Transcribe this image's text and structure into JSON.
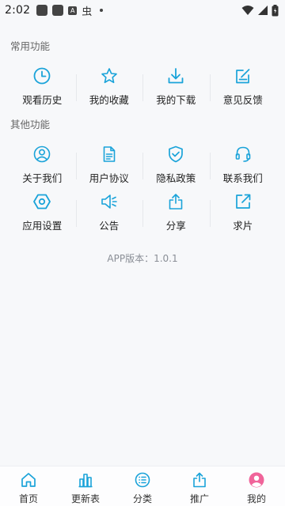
{
  "status_bar": {
    "time": "2:02",
    "notif_letter": "A",
    "notif_glyph": "虫"
  },
  "accent_color": "#1aa3d9",
  "avatar_color": "#f0649a",
  "sections": [
    {
      "title": "常用功能",
      "rows": [
        [
          {
            "label": "观看历史",
            "icon": "clock-icon"
          },
          {
            "label": "我的收藏",
            "icon": "star-icon"
          },
          {
            "label": "我的下载",
            "icon": "download-icon"
          },
          {
            "label": "意见反馈",
            "icon": "edit-icon"
          }
        ]
      ]
    },
    {
      "title": "其他功能",
      "rows": [
        [
          {
            "label": "关于我们",
            "icon": "user-icon"
          },
          {
            "label": "用户协议",
            "icon": "document-icon"
          },
          {
            "label": "隐私政策",
            "icon": "shield-check-icon"
          },
          {
            "label": "联系我们",
            "icon": "headset-icon"
          }
        ],
        [
          {
            "label": "应用设置",
            "icon": "hexagon-settings-icon"
          },
          {
            "label": "公告",
            "icon": "speaker-icon"
          },
          {
            "label": "分享",
            "icon": "share-icon"
          },
          {
            "label": "求片",
            "icon": "external-link-icon"
          }
        ]
      ]
    }
  ],
  "version_text": "APP版本：1.0.1",
  "tabs": [
    {
      "label": "首页",
      "icon": "home-icon"
    },
    {
      "label": "更新表",
      "icon": "chart-icon"
    },
    {
      "label": "分类",
      "icon": "category-icon"
    },
    {
      "label": "推广",
      "icon": "share-up-icon"
    },
    {
      "label": "我的",
      "icon": "avatar-icon",
      "active": true
    }
  ]
}
